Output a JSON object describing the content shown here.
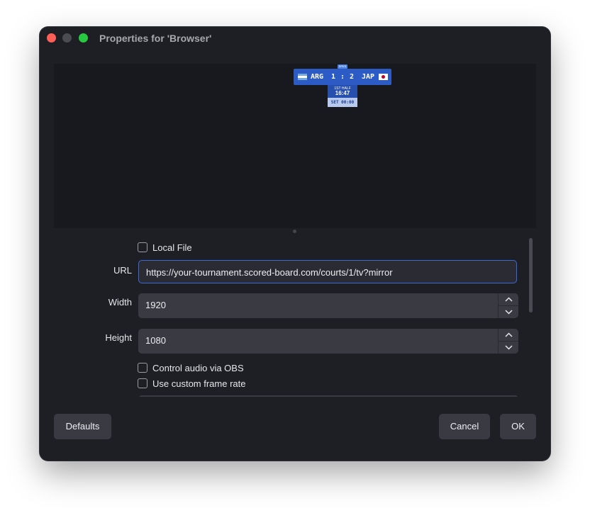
{
  "window": {
    "title": "Properties for 'Browser'"
  },
  "preview": {
    "scoreboard": {
      "badge": "SPES",
      "team1": "ARG",
      "score1": "1",
      "separator": ":",
      "score2": "2",
      "team2": "JAP",
      "period": "1ST HALF",
      "clock": "16:47",
      "set_text": "SET 00:00"
    }
  },
  "form": {
    "local_file_label": "Local File",
    "url_label": "URL",
    "url_value": "https://your-tournament.scored-board.com/courts/1/tv?mirror",
    "width_label": "Width",
    "width_value": "1920",
    "height_label": "Height",
    "height_value": "1080",
    "control_audio_label": "Control audio via OBS",
    "custom_frame_rate_label": "Use custom frame rate"
  },
  "buttons": {
    "defaults": "Defaults",
    "cancel": "Cancel",
    "ok": "OK"
  },
  "colors": {
    "window_bg": "#1e1f25",
    "accent": "#3c69d9",
    "close": "#ff5f57",
    "maximize": "#28c840",
    "scoreboard_blue": "#2d5bc6"
  },
  "icons": [
    "close-icon",
    "minimize-icon",
    "maximize-icon",
    "chevron-up-icon",
    "chevron-down-icon",
    "argentina-flag-icon",
    "japan-flag-icon"
  ]
}
